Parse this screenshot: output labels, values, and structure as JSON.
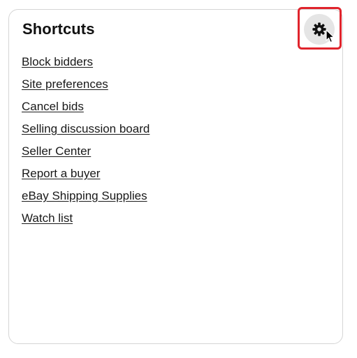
{
  "shortcuts": {
    "title": "Shortcuts",
    "settings_icon": "gear-icon",
    "links": [
      {
        "label": "Block bidders"
      },
      {
        "label": "Site preferences"
      },
      {
        "label": "Cancel bids"
      },
      {
        "label": "Selling discussion board"
      },
      {
        "label": "Seller Center"
      },
      {
        "label": "Report a buyer"
      },
      {
        "label": "eBay Shipping Supplies"
      },
      {
        "label": "Watch list"
      }
    ]
  },
  "colors": {
    "highlight": "#e0242c",
    "settings_button_bg": "#e5e5e5",
    "text": "#191919"
  }
}
